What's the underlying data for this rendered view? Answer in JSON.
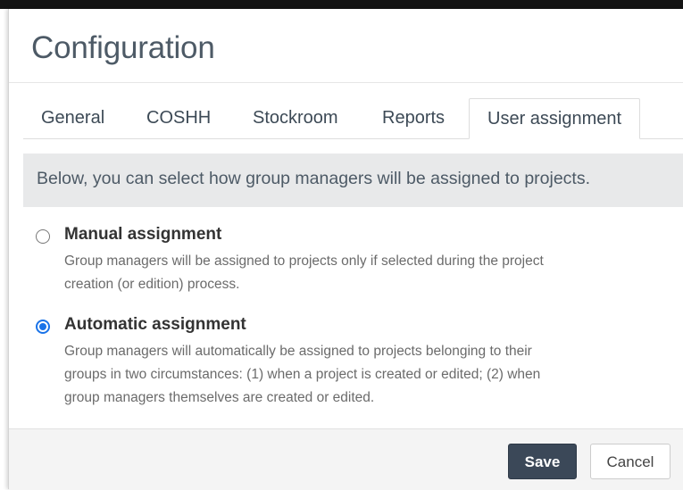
{
  "dialog": {
    "title": "Configuration"
  },
  "tabs": [
    {
      "label": "General",
      "active": false
    },
    {
      "label": "COSHH",
      "active": false
    },
    {
      "label": "Stockroom",
      "active": false
    },
    {
      "label": "Reports",
      "active": false
    },
    {
      "label": "User assignment",
      "active": true
    }
  ],
  "info": {
    "text": "Below, you can select how group managers will be assigned to projects."
  },
  "options": [
    {
      "label": "Manual assignment",
      "checked": false,
      "desc_lines": [
        "Group managers will be assigned to projects only if selected during the project",
        "creation (or edition) process."
      ]
    },
    {
      "label": "Automatic assignment",
      "checked": true,
      "desc_lines": [
        "Group managers will automatically be assigned to projects belonging to their",
        "groups in two circumstances: (1) when a project is created or edited; (2) when",
        "group managers themselves are created or edited."
      ]
    }
  ],
  "footer": {
    "save_label": "Save",
    "cancel_label": "Cancel"
  },
  "colors": {
    "radio_checked": "#1a73e8",
    "save_button_bg": "#3b4858",
    "info_bar_bg": "#e8e9ea"
  }
}
